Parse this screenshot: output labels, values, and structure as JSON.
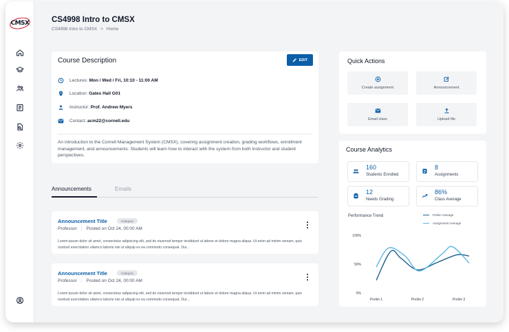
{
  "app": {
    "logo_text": "CMSX"
  },
  "header": {
    "title": "CS4998 Intro to CMSX",
    "breadcrumb": [
      "CS4998 Intro to CMSX",
      ">",
      "Home"
    ]
  },
  "sidebar": {
    "items": [
      {
        "icon": "home-icon"
      },
      {
        "icon": "graduation-cap-icon"
      },
      {
        "icon": "people-icon"
      },
      {
        "icon": "document-icon"
      },
      {
        "icon": "report-icon"
      },
      {
        "icon": "settings-icon"
      }
    ],
    "bottom_icon": "account-icon"
  },
  "course_description": {
    "heading": "Course Description",
    "edit_label": "EDIT",
    "lectures_label": "Lectures:",
    "lectures_value": "Mon / Wed / Fri, 10:10 - 11:00 AM",
    "location_label": "Location:",
    "location_value": "Gates Hall G01",
    "instructor_label": "Instructor:",
    "instructor_value": "Prof. Andrew Myers",
    "contact_label": "Contact:",
    "contact_value": "acm22@cornell.edu",
    "paragraph": "An introduction to the Cornell Management System (CMSX), covering assignment creation, grading workflows, enrollment management, and announcements. Students will learn how to interact with the system from both instructor and student perspectives."
  },
  "tabs": [
    {
      "label": "Announcements",
      "active": true
    },
    {
      "label": "Emails",
      "active": false
    }
  ],
  "announcements": [
    {
      "title": "Announcement Title",
      "category": "Category",
      "author": "Professor",
      "posted": "Posted on Oct 24, 00:00 AM",
      "body": "Lorem ipsum dolor sit amet, consectetur adipiscing elit, sed do eiusmod tempor incididunt ut labore et dolore magna aliqua. Ut enim ad minim veniam, quis nostrud exercitation ullamco laboris nisi ut aliquip ex ea commodo consequat. Dui..."
    },
    {
      "title": "Announcement Title",
      "category": "Category",
      "author": "Professor",
      "posted": "Posted on Oct 24, 00:00 AM",
      "body": "Lorem ipsum dolor sit amet, consectetur adipiscing elit, sed do eiusmod tempor incididunt ut labore et dolore magna aliqua. Ut enim ad minim veniam, quis nostrud exercitation ullamco laboris nisi ut aliquip ex ea commodo consequat. Dui..."
    }
  ],
  "quick_actions": {
    "heading": "Quick Actions",
    "buttons": [
      {
        "label": "Create assignment",
        "icon": "plus-circle-icon"
      },
      {
        "label": "Announcement",
        "icon": "edit-note-icon"
      },
      {
        "label": "Email class",
        "icon": "mail-icon"
      },
      {
        "label": "Upload file",
        "icon": "upload-icon"
      }
    ]
  },
  "analytics": {
    "heading": "Course Analytics",
    "stats": [
      {
        "value": "160",
        "label": "Students Enrolled",
        "icon": "people-icon"
      },
      {
        "value": "8",
        "label": "Assignments",
        "icon": "assignment-icon"
      },
      {
        "value": "12",
        "label": "Needs Grading",
        "icon": "clipboard-icon"
      },
      {
        "value": "86%",
        "label": "Class Average",
        "icon": "trend-up-icon"
      }
    ],
    "perf_title": "Performance Trend"
  },
  "colors": {
    "accent": "#0b5ea8",
    "series_dark": "#1d5f8a",
    "series_light": "#5bb5e6"
  },
  "chart_data": {
    "type": "line",
    "title": "Performance Trend",
    "x": [
      "Prelim 1",
      "Prelim 2",
      "Prelim 3"
    ],
    "y_ticks": [
      "0%",
      "50%",
      "100%"
    ],
    "ylim": [
      0,
      100
    ],
    "legend_position": "top-right",
    "series": [
      {
        "name": "Prelim Average",
        "color": "#1d5f8a",
        "points": [
          [
            0,
            22
          ],
          [
            0.35,
            72
          ],
          [
            0.6,
            60
          ],
          [
            1.0,
            40
          ],
          [
            1.45,
            52
          ],
          [
            1.95,
            66
          ],
          [
            2.25,
            64
          ]
        ]
      },
      {
        "name": "Assignment Average",
        "color": "#5bb5e6",
        "points": [
          [
            0,
            45
          ],
          [
            0.3,
            78
          ],
          [
            0.7,
            64
          ],
          [
            1.05,
            38
          ],
          [
            1.6,
            68
          ],
          [
            1.85,
            80
          ],
          [
            2.25,
            52
          ]
        ]
      }
    ]
  }
}
